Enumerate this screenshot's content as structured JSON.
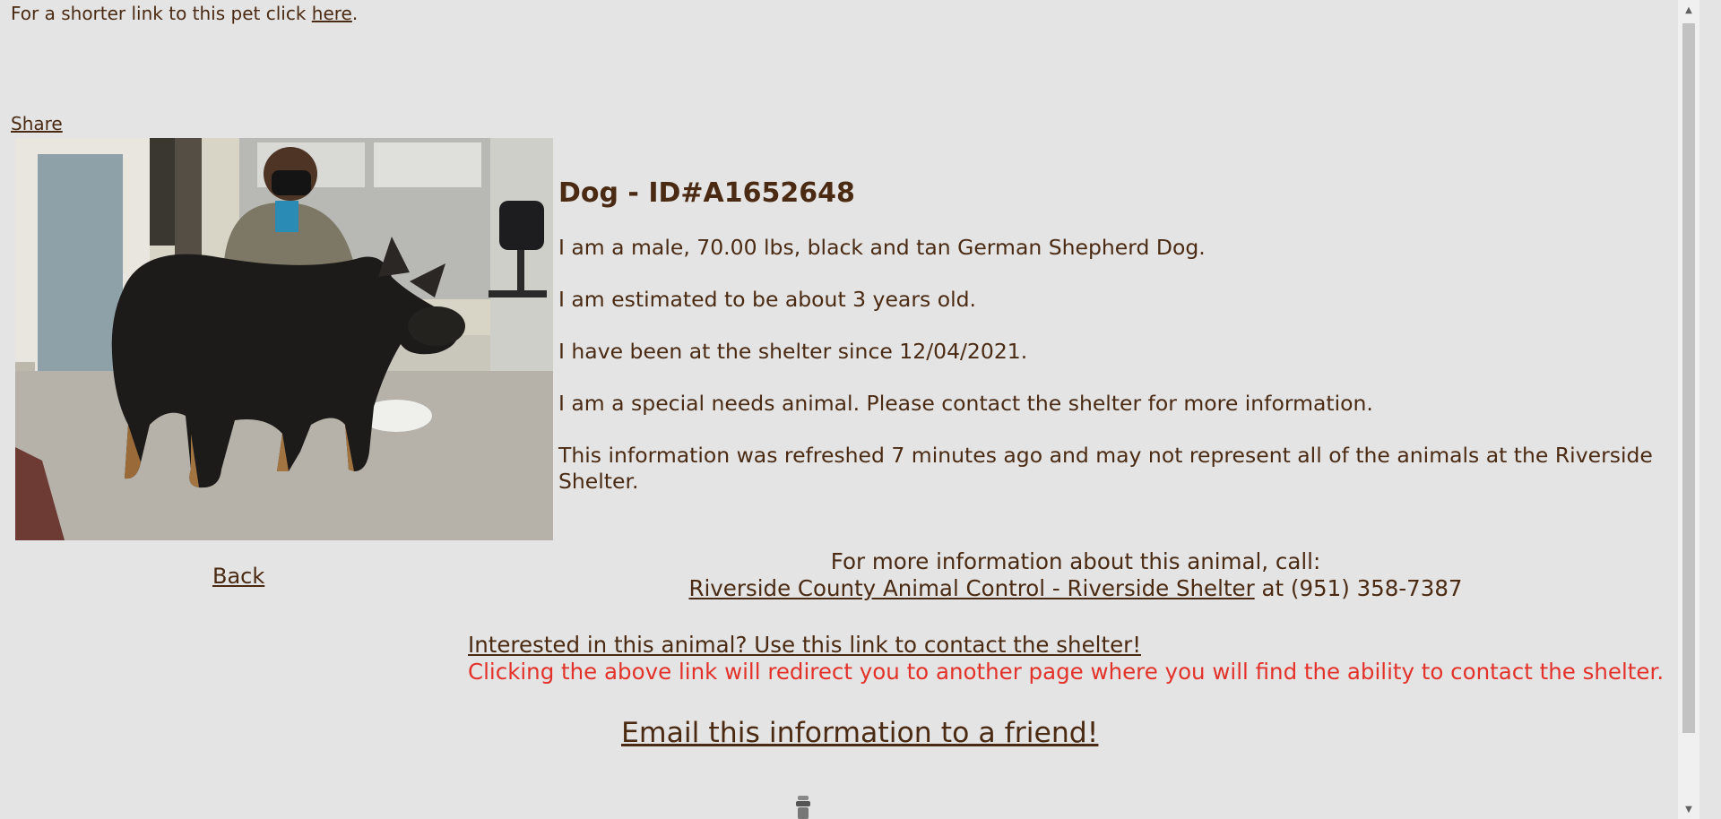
{
  "top": {
    "shorter_link_text": "For a shorter link to this pet click ",
    "here_link": "here",
    "period": "."
  },
  "share_label": "Share",
  "back_label": "Back",
  "animal": {
    "heading": "Dog - ID#A1652648",
    "line_description": "I am a male, 70.00 lbs, black and tan German Shepherd Dog.",
    "line_age": "I am estimated to be about 3 years old.",
    "line_since": "I have been at the shelter since 12/04/2021.",
    "line_special": "I am a special needs animal. Please contact the shelter for more information.",
    "line_refresh": "This information was refreshed 7 minutes ago and may not represent all of the animals at the Riverside Shelter."
  },
  "callout": {
    "line1": "For more information about this animal, call:",
    "shelter_link": "Riverside County Animal Control - Riverside Shelter",
    "at_phone": " at (951) 358-7387"
  },
  "contact": {
    "link": "Interested in this animal? Use this link to contact the shelter!",
    "note": "Clicking the above link will redirect you to another page where you will find the ability to contact the shelter.",
    "note_color": "#e3322a"
  },
  "email_link": "Email this information to a friend!",
  "colors": {
    "background": "#e4e4e4",
    "text": "#4a2a12"
  },
  "icons": {
    "photo": "german-shepherd-dog-photo",
    "loading": "loading-spinner-icon"
  }
}
